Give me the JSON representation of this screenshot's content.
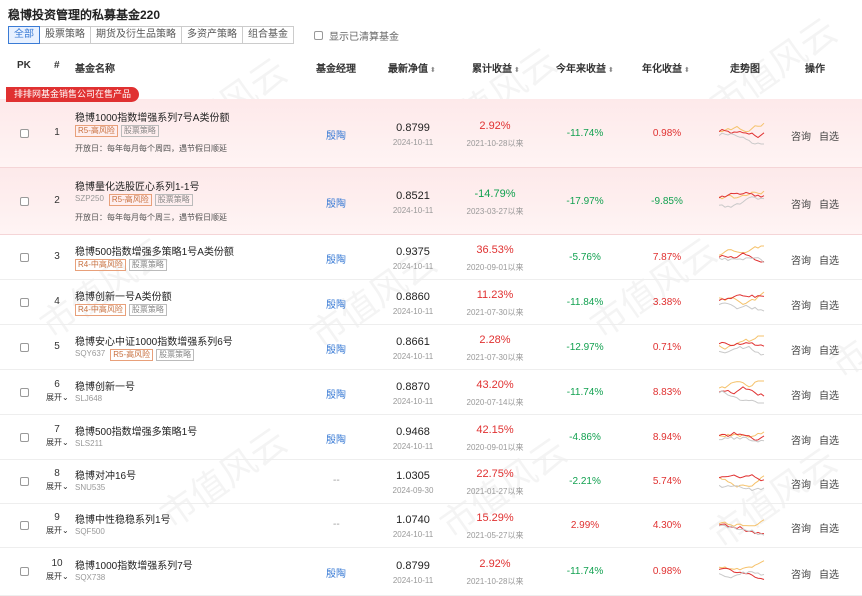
{
  "title": "稳博投资管理的私募基金220",
  "tabs": [
    {
      "label": "全部",
      "active": true
    },
    {
      "label": "股票策略",
      "active": false
    },
    {
      "label": "期货及衍生品策略",
      "active": false
    },
    {
      "label": "多资产策略",
      "active": false
    },
    {
      "label": "组合基金",
      "active": false
    }
  ],
  "show_cleared_label": "显示已清算基金",
  "headers": {
    "pk": "PK",
    "idx": "#",
    "name": "基金名称",
    "manager": "基金经理",
    "nav": "最新净值",
    "cum": "累计收益",
    "ytd": "今年来收益",
    "annual": "年化收益",
    "trend": "走势图",
    "ops": "操作",
    "sort_icon": "⬍"
  },
  "promo_badge": "排排网基金销售公司在售产品",
  "ops": {
    "consult": "咨询",
    "watch": "自选"
  },
  "colors": {
    "up": "#e03131",
    "down": "#12a150",
    "link": "#3a7bd5"
  },
  "watermark": "市值风云",
  "rows": [
    {
      "num": "1",
      "name": "稳博1000指数增强系列7号A类份额",
      "code": "",
      "tags": [
        "R5-高风险",
        "股票策略"
      ],
      "open": "开放日：每年每月每个周四，遇节假日顺延",
      "expand": "",
      "manager": "殷陶",
      "nav": "0.8799",
      "nav_date": "2024-10-11",
      "cum": "2.92%",
      "cum_dir": "up",
      "since": "2021-10-28以来",
      "ytd": "-11.74%",
      "ytd_dir": "down",
      "annual": "0.98%",
      "annual_dir": "up",
      "promo": true
    },
    {
      "num": "2",
      "name": "稳博量化选股匠心系列1-1号",
      "code": "SZP250",
      "tags": [
        "R5-高风险",
        "股票策略"
      ],
      "open": "开放日：每年每月每个周三，遇节假日顺延",
      "expand": "",
      "manager": "殷陶",
      "nav": "0.8521",
      "nav_date": "2024-10-11",
      "cum": "-14.79%",
      "cum_dir": "down",
      "since": "2023-03-27以来",
      "ytd": "-17.97%",
      "ytd_dir": "down",
      "annual": "-9.85%",
      "annual_dir": "down",
      "promo": true
    },
    {
      "num": "3",
      "name": "稳博500指数增强多策略1号A类份额",
      "code": "",
      "tags": [
        "R4-中高风险",
        "股票策略"
      ],
      "open": "",
      "expand": "",
      "manager": "殷陶",
      "nav": "0.9375",
      "nav_date": "2024-10-11",
      "cum": "36.53%",
      "cum_dir": "up",
      "since": "2020-09-01以来",
      "ytd": "-5.76%",
      "ytd_dir": "down",
      "annual": "7.87%",
      "annual_dir": "up",
      "promo": false
    },
    {
      "num": "4",
      "name": "稳博创新一号A类份额",
      "code": "",
      "tags": [
        "R4-中高风险",
        "股票策略"
      ],
      "open": "",
      "expand": "",
      "manager": "殷陶",
      "nav": "0.8860",
      "nav_date": "2024-10-11",
      "cum": "11.23%",
      "cum_dir": "up",
      "since": "2021-07-30以来",
      "ytd": "-11.84%",
      "ytd_dir": "down",
      "annual": "3.38%",
      "annual_dir": "up",
      "promo": false
    },
    {
      "num": "5",
      "name": "稳博安心中证1000指数增强系列6号",
      "code": "SQY637",
      "tags": [
        "R5-高风险",
        "股票策略"
      ],
      "open": "",
      "expand": "",
      "manager": "殷陶",
      "nav": "0.8661",
      "nav_date": "2024-10-11",
      "cum": "2.28%",
      "cum_dir": "up",
      "since": "2021-07-30以来",
      "ytd": "-12.97%",
      "ytd_dir": "down",
      "annual": "0.71%",
      "annual_dir": "up",
      "promo": false
    },
    {
      "num": "6",
      "name": "稳博创新一号",
      "code": "SLJ648",
      "tags": [],
      "open": "",
      "expand": "展开⌄",
      "manager": "殷陶",
      "nav": "0.8870",
      "nav_date": "2024-10-11",
      "cum": "43.20%",
      "cum_dir": "up",
      "since": "2020-07-14以来",
      "ytd": "-11.74%",
      "ytd_dir": "down",
      "annual": "8.83%",
      "annual_dir": "up",
      "promo": false
    },
    {
      "num": "7",
      "name": "稳博500指数增强多策略1号",
      "code": "SLS211",
      "tags": [],
      "open": "",
      "expand": "展开⌄",
      "manager": "殷陶",
      "nav": "0.9468",
      "nav_date": "2024-10-11",
      "cum": "42.15%",
      "cum_dir": "up",
      "since": "2020-09-01以来",
      "ytd": "-4.86%",
      "ytd_dir": "down",
      "annual": "8.94%",
      "annual_dir": "up",
      "promo": false
    },
    {
      "num": "8",
      "name": "稳博对冲16号",
      "code": "SNU535",
      "tags": [],
      "open": "",
      "expand": "展开⌄",
      "manager": "--",
      "nav": "1.0305",
      "nav_date": "2024-09-30",
      "cum": "22.75%",
      "cum_dir": "up",
      "since": "2021-01-27以来",
      "ytd": "-2.21%",
      "ytd_dir": "down",
      "annual": "5.74%",
      "annual_dir": "up",
      "promo": false
    },
    {
      "num": "9",
      "name": "稳博中性稳稳系列1号",
      "code": "SQF500",
      "tags": [],
      "open": "",
      "expand": "展开⌄",
      "manager": "--",
      "nav": "1.0740",
      "nav_date": "2024-10-11",
      "cum": "15.29%",
      "cum_dir": "up",
      "since": "2021-05-27以来",
      "ytd": "2.99%",
      "ytd_dir": "up",
      "annual": "4.30%",
      "annual_dir": "up",
      "promo": false
    },
    {
      "num": "10",
      "name": "稳博1000指数增强系列7号",
      "code": "SQX738",
      "tags": [],
      "open": "",
      "expand": "展开⌄",
      "manager": "殷陶",
      "nav": "0.8799",
      "nav_date": "2024-10-11",
      "cum": "2.92%",
      "cum_dir": "up",
      "since": "2021-10-28以来",
      "ytd": "-11.74%",
      "ytd_dir": "down",
      "annual": "0.98%",
      "annual_dir": "up",
      "promo": false
    }
  ]
}
